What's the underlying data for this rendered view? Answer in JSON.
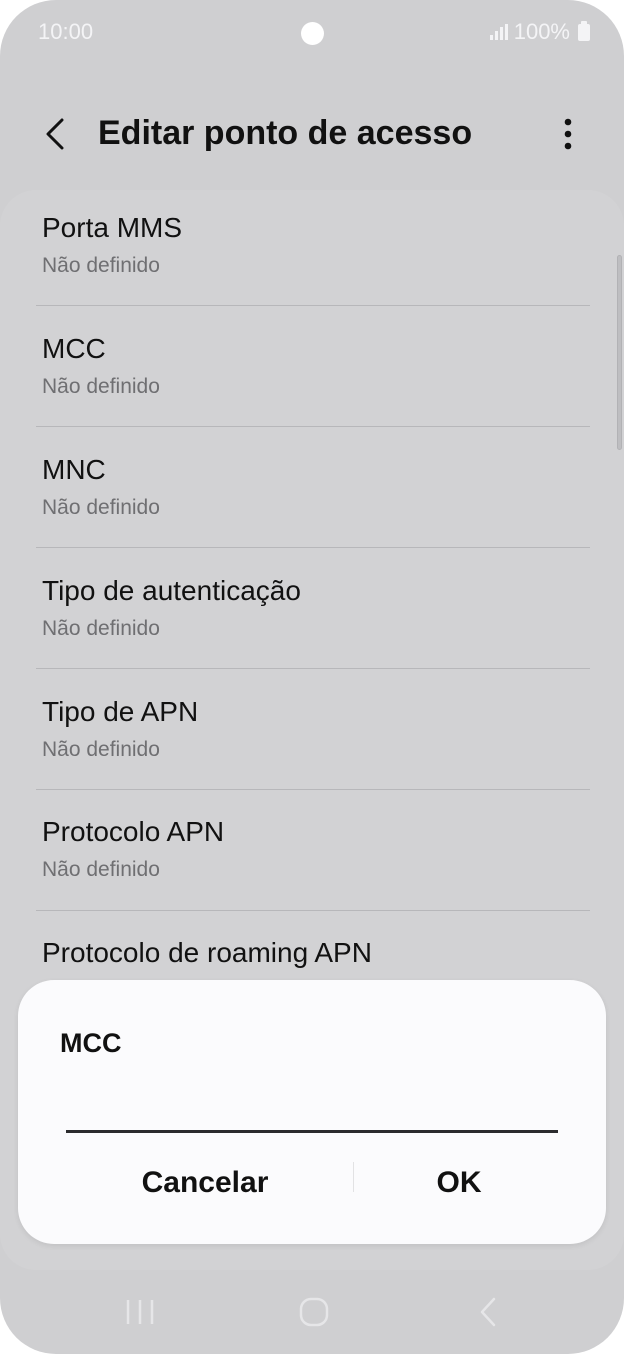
{
  "status_bar": {
    "time": "10:00",
    "battery_text": "100%",
    "icons": [
      "camera-dot",
      "signal-icon",
      "battery-icon"
    ]
  },
  "header": {
    "title": "Editar ponto de acesso",
    "back_icon": "chevron-left-icon",
    "more_icon": "more-vert-icon"
  },
  "settings": {
    "items": [
      {
        "label": "Porta MMS",
        "value": "Não definido"
      },
      {
        "label": "MCC",
        "value": "Não definido"
      },
      {
        "label": "MNC",
        "value": "Não definido"
      },
      {
        "label": "Tipo de autenticação",
        "value": "Não definido"
      },
      {
        "label": "Tipo de APN",
        "value": "Não definido"
      },
      {
        "label": "Protocolo APN",
        "value": "Não definido"
      },
      {
        "label": "Protocolo de roaming APN",
        "value": ""
      }
    ]
  },
  "dialog": {
    "title": "MCC",
    "input_value": "",
    "cancel_label": "Cancelar",
    "ok_label": "OK"
  },
  "navigation": {
    "icons": [
      "recent-apps-icon",
      "home-icon",
      "back-icon"
    ]
  },
  "colors": {
    "background": "#cfcfd1",
    "card": "#d2d2d4",
    "dialog": "#fbfbfd",
    "text": "#111111",
    "secondary_text": "#6f6f72"
  }
}
